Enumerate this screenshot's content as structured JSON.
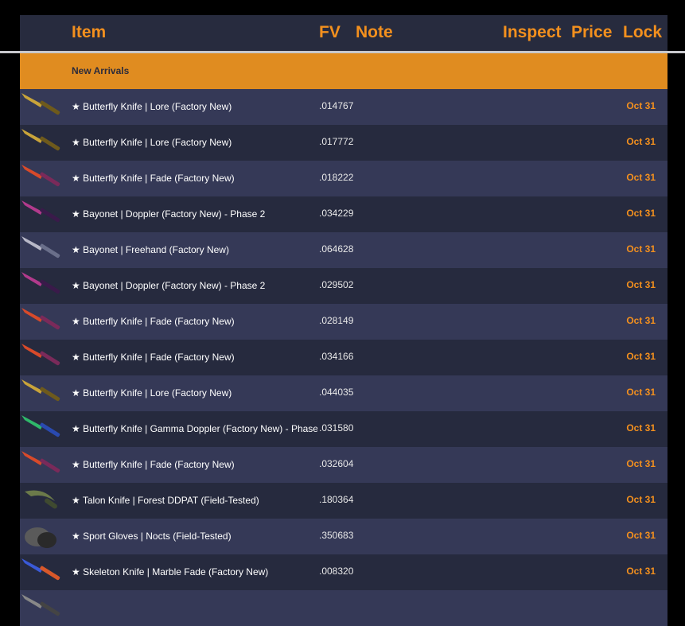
{
  "header": {
    "item": "Item",
    "fv": "FV",
    "note": "Note",
    "inspect": "Inspect",
    "price": "Price",
    "lock": "Lock"
  },
  "section_title": "New Arrivals",
  "rows": [
    {
      "name": "★ Butterfly Knife | Lore (Factory New)",
      "fv": ".014767",
      "lock": "Oct 31",
      "icon": "butterfly-knife-lore-icon"
    },
    {
      "name": "★ Butterfly Knife | Lore (Factory New)",
      "fv": ".017772",
      "lock": "Oct 31",
      "icon": "butterfly-knife-lore-icon"
    },
    {
      "name": "★ Butterfly Knife | Fade (Factory New)",
      "fv": ".018222",
      "lock": "Oct 31",
      "icon": "butterfly-knife-fade-icon"
    },
    {
      "name": "★ Bayonet | Doppler (Factory New) - Phase 2",
      "fv": ".034229",
      "lock": "Oct 31",
      "icon": "bayonet-doppler-icon"
    },
    {
      "name": "★ Bayonet | Freehand (Factory New)",
      "fv": ".064628",
      "lock": "Oct 31",
      "icon": "bayonet-freehand-icon"
    },
    {
      "name": "★ Bayonet | Doppler (Factory New) - Phase 2",
      "fv": ".029502",
      "lock": "Oct 31",
      "icon": "bayonet-doppler-icon"
    },
    {
      "name": "★ Butterfly Knife | Fade (Factory New)",
      "fv": ".028149",
      "lock": "Oct 31",
      "icon": "butterfly-knife-fade-icon"
    },
    {
      "name": "★ Butterfly Knife | Fade (Factory New)",
      "fv": ".034166",
      "lock": "Oct 31",
      "icon": "butterfly-knife-fade-icon"
    },
    {
      "name": "★ Butterfly Knife | Lore (Factory New)",
      "fv": ".044035",
      "lock": "Oct 31",
      "icon": "butterfly-knife-lore-icon"
    },
    {
      "name": "★ Butterfly Knife | Gamma Doppler (Factory New) - Phase",
      "fv": ".031580",
      "lock": "Oct 31",
      "icon": "butterfly-knife-gamma-doppler-icon"
    },
    {
      "name": "★ Butterfly Knife | Fade (Factory New)",
      "fv": ".032604",
      "lock": "Oct 31",
      "icon": "butterfly-knife-fade-icon"
    },
    {
      "name": "★ Talon Knife | Forest DDPAT (Field-Tested)",
      "fv": ".180364",
      "lock": "Oct 31",
      "icon": "talon-knife-forest-icon"
    },
    {
      "name": "★ Sport Gloves | Nocts (Field-Tested)",
      "fv": ".350683",
      "lock": "Oct 31",
      "icon": "sport-gloves-icon"
    },
    {
      "name": "★ Skeleton Knife | Marble Fade (Factory New)",
      "fv": ".008320",
      "lock": "Oct 31",
      "icon": "skeleton-knife-marble-fade-icon"
    },
    {
      "name": "",
      "fv": "",
      "lock": "",
      "icon": "item-icon"
    }
  ]
}
